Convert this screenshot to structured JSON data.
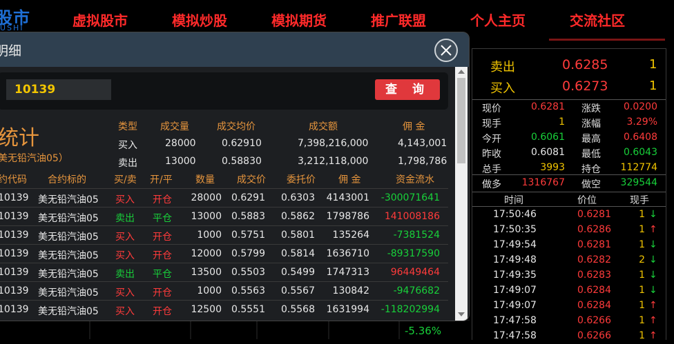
{
  "logo": {
    "text": "股市",
    "sub": "USHI"
  },
  "nav": {
    "items": [
      "虚拟股市",
      "模拟炒股",
      "模拟期货",
      "推广联盟",
      "个人主页",
      "交流社区"
    ]
  },
  "dialog": {
    "title": "明细",
    "code_value": "10139",
    "query_label": "查 询",
    "stat_title": "统计",
    "stat_subtitle": "美无铅汽油05）",
    "stat_headers": [
      "类型",
      "成交量",
      "成交均价",
      "成交额",
      "佣 金"
    ],
    "stat_rows": [
      {
        "type": "买入",
        "volume": "28000",
        "avg_price": "0.62910",
        "amount": "7,398,216,000",
        "commission": "4,143,001"
      },
      {
        "type": "卖出",
        "volume": "13000",
        "avg_price": "0.58830",
        "amount": "3,212,118,000",
        "commission": "1,798,786"
      }
    ],
    "table_headers": [
      "约代码",
      "合约标的",
      "买/卖",
      "开/平",
      "数量",
      "成交价",
      "委托价",
      "佣 金",
      "资金流水"
    ],
    "rows": [
      {
        "code": "10139",
        "name": "美无铅汽油05",
        "side": "买入",
        "oc": "开仓",
        "qty": "28000",
        "price": "0.6291",
        "order": "0.6303",
        "comm": "4143001",
        "flow": "-300071641"
      },
      {
        "code": "10139",
        "name": "美无铅汽油05",
        "side": "卖出",
        "oc": "平仓",
        "qty": "13000",
        "price": "0.5883",
        "order": "0.5862",
        "comm": "1798786",
        "flow": "141008186"
      },
      {
        "code": "10139",
        "name": "美无铅汽油05",
        "side": "买入",
        "oc": "开仓",
        "qty": "1000",
        "price": "0.5751",
        "order": "0.5801",
        "comm": "135264",
        "flow": "-7381524"
      },
      {
        "code": "10139",
        "name": "美无铅汽油05",
        "side": "买入",
        "oc": "开仓",
        "qty": "12000",
        "price": "0.5799",
        "order": "0.5814",
        "comm": "1636710",
        "flow": "-89317590"
      },
      {
        "code": "10139",
        "name": "美无铅汽油05",
        "side": "卖出",
        "oc": "平仓",
        "qty": "13500",
        "price": "0.5503",
        "order": "0.5499",
        "comm": "1747313",
        "flow": "96449464"
      },
      {
        "code": "10139",
        "name": "美无铅汽油05",
        "side": "买入",
        "oc": "开仓",
        "qty": "1000",
        "price": "0.5563",
        "order": "0.5567",
        "comm": "130842",
        "flow": "-9476682"
      },
      {
        "code": "10139",
        "name": "美无铅汽油05",
        "side": "买入",
        "oc": "开仓",
        "qty": "12500",
        "price": "0.5551",
        "order": "0.5568",
        "comm": "1631994",
        "flow": "-118202994"
      }
    ]
  },
  "quote": {
    "sell_label": "卖出",
    "sell_price": "0.6285",
    "sell_qty": "1",
    "buy_label": "买入",
    "buy_price": "0.6273",
    "buy_qty": "1",
    "stats": [
      {
        "l1": "现价",
        "v1": "0.6281",
        "c1": "red",
        "l2": "涨跌",
        "v2": "0.0200",
        "c2": "red"
      },
      {
        "l1": "现手",
        "v1": "1",
        "c1": "yellow",
        "l2": "涨幅",
        "v2": "3.29%",
        "c2": "red"
      },
      {
        "l1": "今开",
        "v1": "0.6061",
        "c1": "green",
        "l2": "最高",
        "v2": "0.6408",
        "c2": "red"
      },
      {
        "l1": "昨收",
        "v1": "0.6081",
        "c1": "white",
        "l2": "最低",
        "v2": "0.6043",
        "c2": "green"
      },
      {
        "l1": "总手",
        "v1": "3993",
        "c1": "yellow",
        "l2": "持仓",
        "v2": "112774",
        "c2": "yellow"
      }
    ],
    "long_label": "做多",
    "long_value": "1316767",
    "short_label": "做空",
    "short_value": "329544",
    "tick_headers": [
      "时间",
      "价位",
      "现手"
    ],
    "ticks": [
      {
        "time": "17:50:46",
        "price": "0.6281",
        "qty": "1",
        "dir": "down"
      },
      {
        "time": "17:50:35",
        "price": "0.6286",
        "qty": "1",
        "dir": "up"
      },
      {
        "time": "17:49:54",
        "price": "0.6281",
        "qty": "1",
        "dir": "down"
      },
      {
        "time": "17:49:48",
        "price": "0.6282",
        "qty": "2",
        "dir": "down"
      },
      {
        "time": "17:49:35",
        "price": "0.6283",
        "qty": "1",
        "dir": "down"
      },
      {
        "time": "17:49:07",
        "price": "0.6284",
        "qty": "1",
        "dir": "down"
      },
      {
        "time": "17:49:07",
        "price": "0.6284",
        "qty": "1",
        "dir": "up"
      },
      {
        "time": "17:47:58",
        "price": "0.6266",
        "qty": "1",
        "dir": "up"
      },
      {
        "time": "17:47:58",
        "price": "0.6266",
        "qty": "1",
        "dir": "up"
      }
    ]
  },
  "background": {
    "pct": "-5.36%"
  },
  "colors": {
    "red": "#ff3b3b",
    "green": "#18d13a",
    "yellow": "#f2c500",
    "orange": "#e6953d",
    "query_button": "#e0383c",
    "dialog_header": "#2f4050"
  }
}
